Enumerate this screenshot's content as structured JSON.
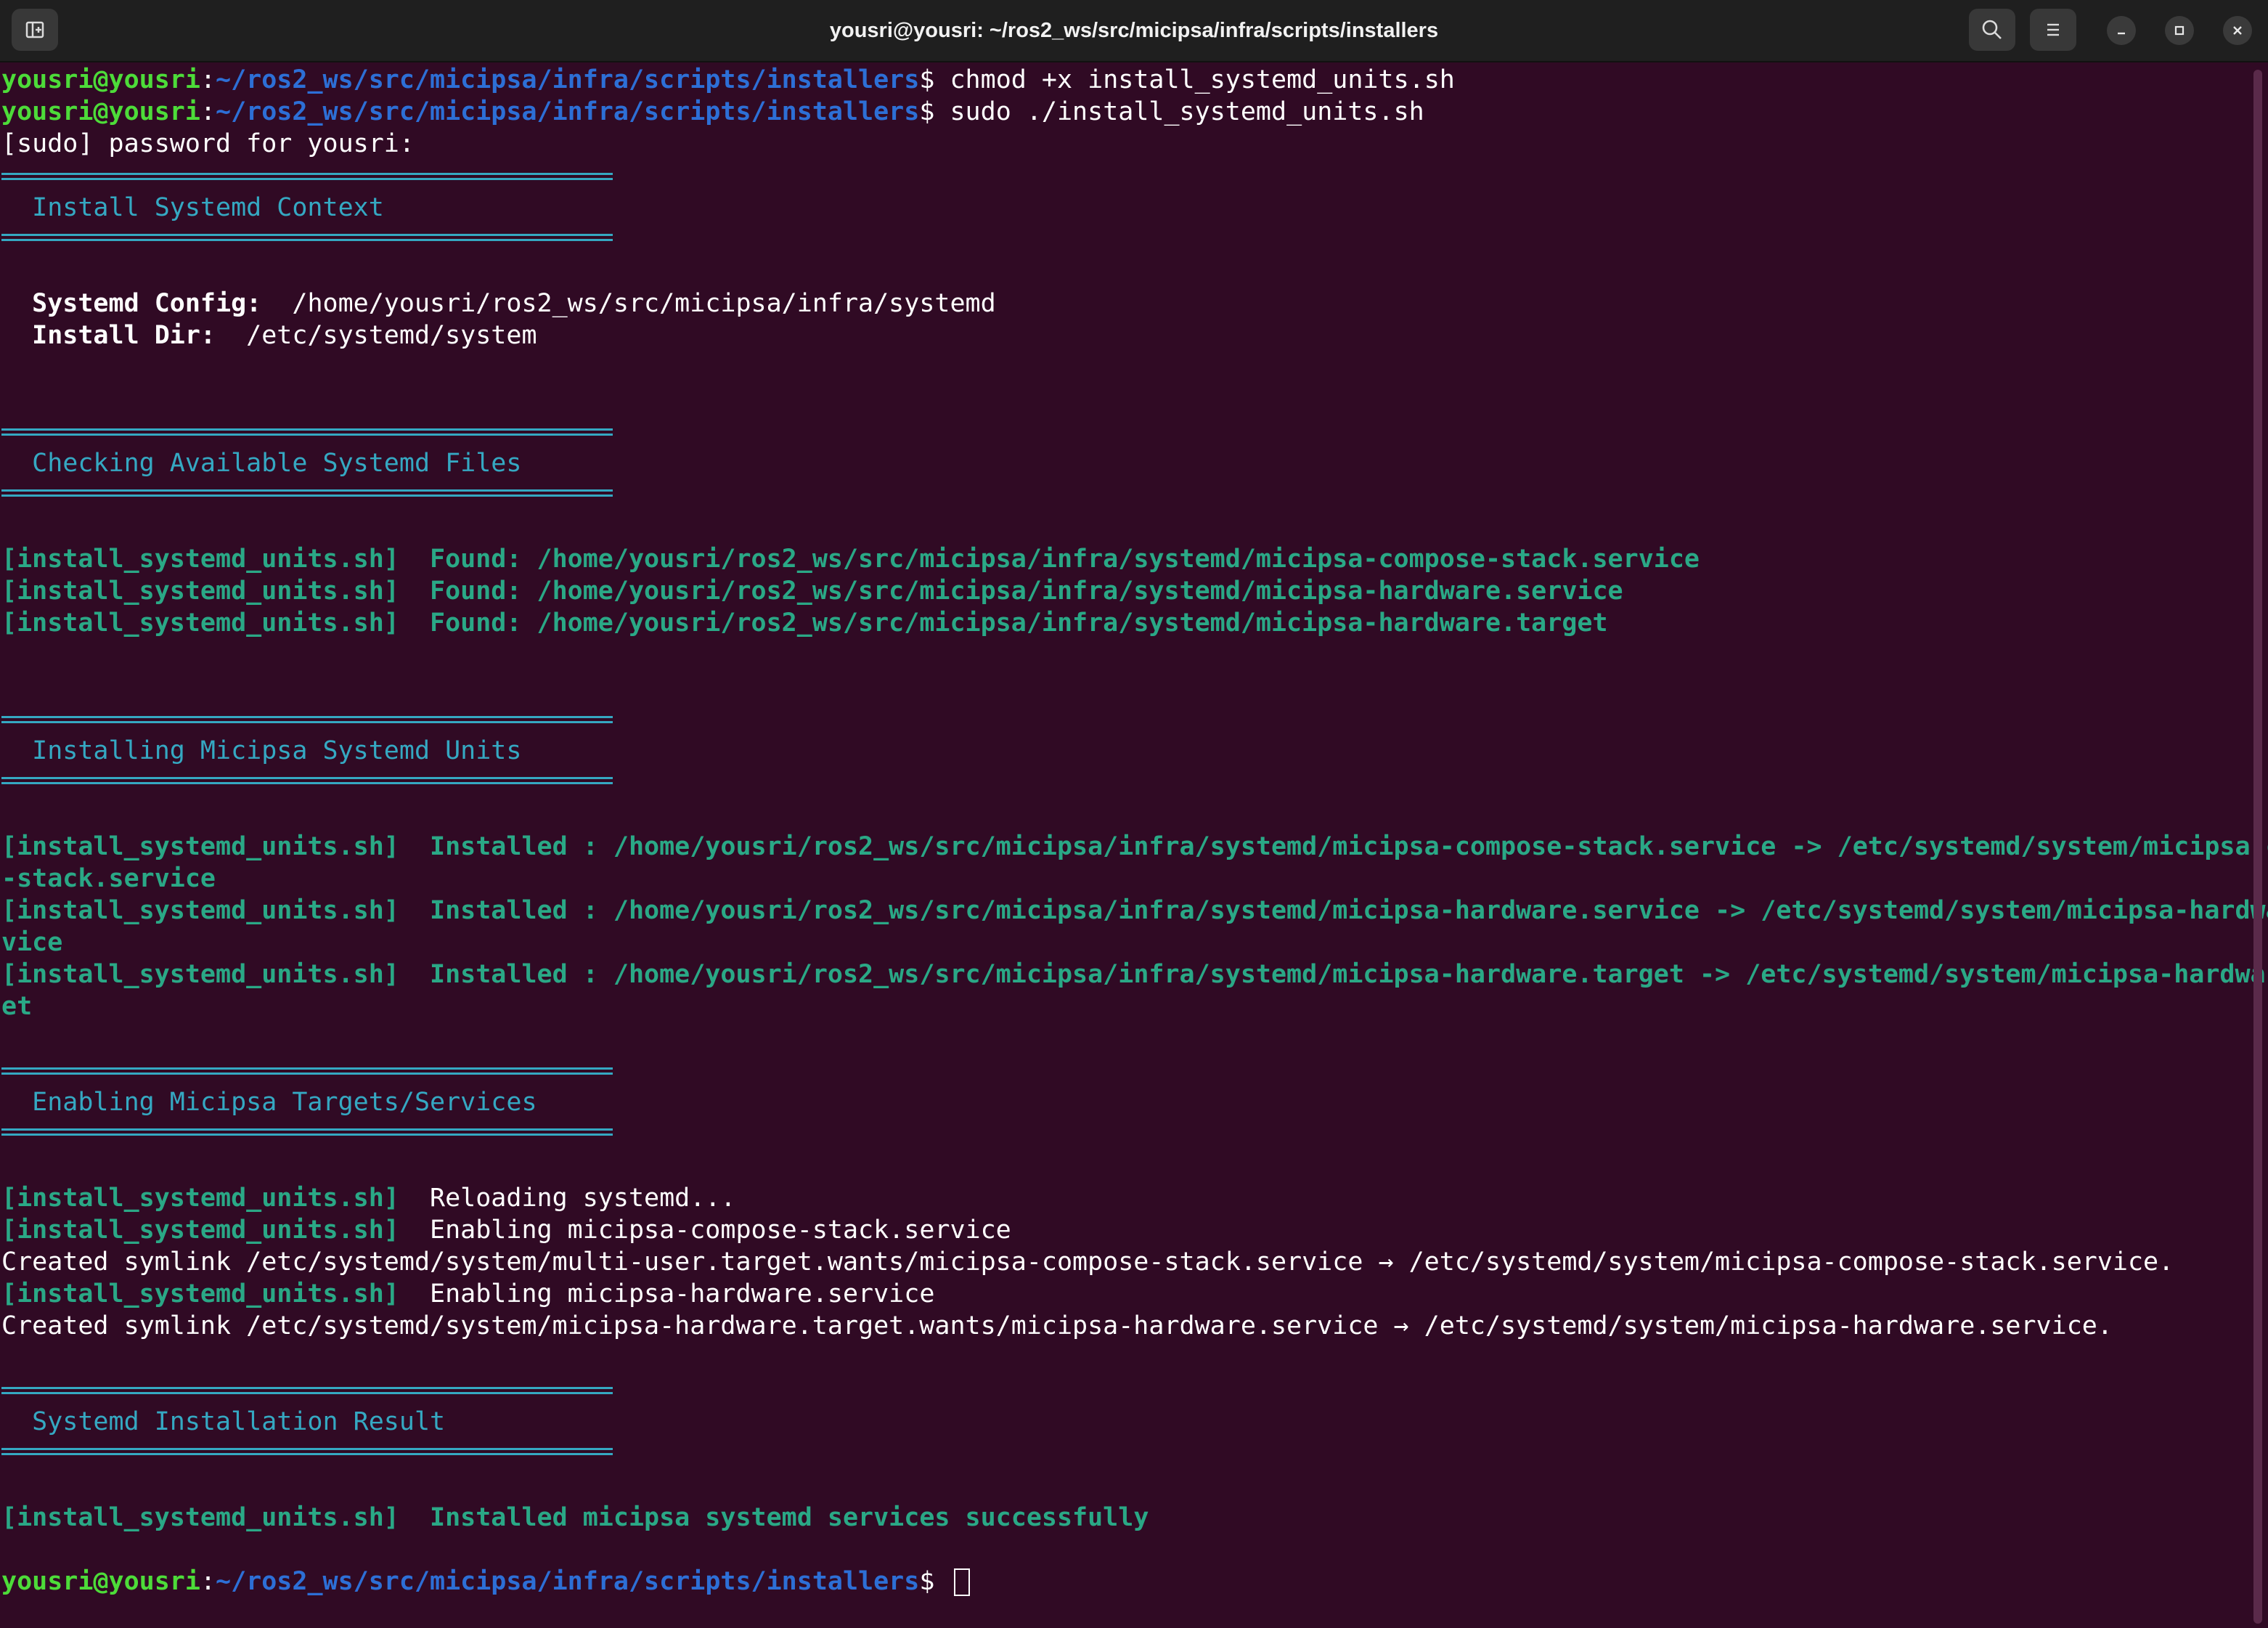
{
  "window": {
    "title": "yousri@yousri: ~/ros2_ws/src/micipsa/infra/scripts/installers",
    "icons": {
      "new_tab": "new-tab-icon",
      "search": "search-icon",
      "menu": "hamburger-menu-icon",
      "minimize": "minimize-icon",
      "maximize": "maximize-icon",
      "close": "close-icon"
    }
  },
  "prompt": {
    "user": "yousri@yousri",
    "colon": ":",
    "path": "~/ros2_ws/src/micipsa/infra/scripts/installers",
    "dollar": "$ "
  },
  "commands": {
    "cmd1": "chmod +x install_systemd_units.sh",
    "cmd2": "sudo ./install_systemd_units.sh"
  },
  "sudo_prompt": "[sudo] password for yousri:",
  "sections": {
    "s1": "  Install Systemd Context",
    "s2": "  Checking Available Systemd Files",
    "s3": "  Installing Micipsa Systemd Units",
    "s4": "  Enabling Micipsa Targets/Services",
    "s5": "  Systemd Installation Result"
  },
  "context": {
    "config_label": "  Systemd Config:",
    "config_value": "  /home/yousri/ros2_ws/src/micipsa/infra/systemd",
    "dir_label": "  Install Dir:",
    "dir_value": "  /etc/systemd/system"
  },
  "tag": "[install_systemd_units.sh]",
  "found": [
    "  Found: /home/yousri/ros2_ws/src/micipsa/infra/systemd/micipsa-compose-stack.service",
    "  Found: /home/yousri/ros2_ws/src/micipsa/infra/systemd/micipsa-hardware.service",
    "  Found: /home/yousri/ros2_ws/src/micipsa/infra/systemd/micipsa-hardware.target"
  ],
  "installed": [
    {
      "a": "  Installed : /home/yousri/ros2_ws/src/micipsa/infra/systemd/micipsa-compose-stack.service -> /etc/systemd/system/micipsa-compose",
      "b": "-stack.service"
    },
    {
      "a": "  Installed : /home/yousri/ros2_ws/src/micipsa/infra/systemd/micipsa-hardware.service -> /etc/systemd/system/micipsa-hardware.ser",
      "b": "vice"
    },
    {
      "a": "  Installed : /home/yousri/ros2_ws/src/micipsa/infra/systemd/micipsa-hardware.target -> /etc/systemd/system/micipsa-hardware.targ",
      "b": "et"
    }
  ],
  "enabling": {
    "reload": "  Reloading systemd...",
    "enable1": "  Enabling micipsa-compose-stack.service",
    "symlink1": "Created symlink /etc/systemd/system/multi-user.target.wants/micipsa-compose-stack.service → /etc/systemd/system/micipsa-compose-stack.service.",
    "enable2": "  Enabling micipsa-hardware.service",
    "symlink2": "Created symlink /etc/systemd/system/micipsa-hardware.target.wants/micipsa-hardware.service → /etc/systemd/system/micipsa-hardware.service."
  },
  "result": "  Installed micipsa systemd services successfully"
}
